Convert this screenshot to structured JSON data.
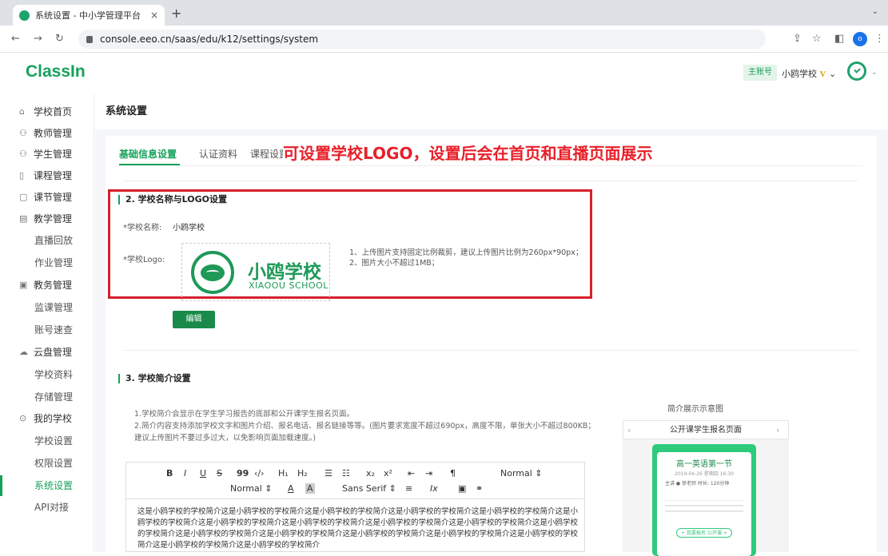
{
  "browser": {
    "tab_title": "系统设置 - 中小学管理平台",
    "tab_close": "×",
    "new_tab": "+",
    "url": "console.eeo.cn/saas/edu/k12/settings/system",
    "profile_initial": "o"
  },
  "header": {
    "logo": "ClassIn",
    "account_badge": "主账号",
    "school_name": "小鸥学校",
    "vip": "V"
  },
  "sidebar": {
    "items": [
      {
        "label": "学校首页",
        "icon": "⌂"
      },
      {
        "label": "教师管理",
        "icon": "⚇"
      },
      {
        "label": "学生管理",
        "icon": "⚇"
      },
      {
        "label": "课程管理",
        "icon": "▯"
      },
      {
        "label": "课节管理",
        "icon": "▢"
      },
      {
        "label": "教学管理",
        "icon": "▤"
      },
      {
        "label": "直播回放"
      },
      {
        "label": "作业管理"
      },
      {
        "label": "教务管理",
        "icon": "▣"
      },
      {
        "label": "监课管理"
      },
      {
        "label": "账号速查"
      },
      {
        "label": "云盘管理",
        "icon": "☁"
      },
      {
        "label": "学校资料"
      },
      {
        "label": "存储管理"
      },
      {
        "label": "我的学校",
        "icon": "⊙"
      },
      {
        "label": "学校设置"
      },
      {
        "label": "权限设置"
      },
      {
        "label": "系统设置"
      },
      {
        "label": "API对接"
      }
    ]
  },
  "page": {
    "title": "系统设置",
    "tabs": [
      "基础信息设置",
      "认证资料",
      "课程设置"
    ],
    "callout": "可设置学校LOGO，设置后会在首页和直播页面展示",
    "section2": {
      "heading": "2. 学校名称与LOGO设置",
      "name_label": "*学校名称:",
      "name_value": "小鸥学校",
      "logo_label": "*学校Logo:",
      "logo_cn": "小鸥学校",
      "logo_en": "XIAOOU SCHOOL",
      "tip1": "1、上传图片支持固定比例裁剪，建议上传图片比例为260px*90px；",
      "tip2": "2、图片大小不超过1MB；",
      "edit_button": "编辑"
    },
    "section3": {
      "heading": "3. 学校简介设置",
      "note1": "1.学校简介会显示在学生学习报告的底部和公开课学生报名页面。",
      "note2": "2.简介内容支持添加学校文字和图片介绍、报名电话、报名链接等等。(图片要求宽度不超过690px，高度不限，单张大小不超过800KB；建议上传图片不要过多过大，以免影响页面加载速度。)",
      "content": "这是小鸥学校的学校简介这是小鸥学校的学校简介这是小鸥学校的学校简介这是小鸥学校的学校简介这是小鸥学校的学校简介这是小鸥学校的学校简介这是小鸥学校的学校简介这是小鸥学校的学校简介这是小鸥学校的学校简介这是小鸥学校的学校简介这是小鸥学校的学校简介这是小鸥学校的学校简介这是小鸥学校的学校简介这是小鸥学校的学校简介这是小鸥学校的学校简介这是小鸥学校的学校简介这是小鸥学校的学校简介这是小鸥学校的学校简介"
    },
    "editor_toolbar": {
      "bold": "B",
      "italic": "I",
      "underline": "U",
      "strike": "S",
      "quote": "99",
      "code": "‹/›",
      "h1": "H₁",
      "h2": "H₂",
      "ol": "☰",
      "ul": "☷",
      "sub": "x₂",
      "sup": "x²",
      "outdent": "⇤",
      "indent": "⇥",
      "rtl": "¶",
      "size_select": "Normal ⇕",
      "header_select": "Normal ⇕",
      "color": "A",
      "bg": "A",
      "font_select": "Sans Serif ⇕",
      "align": "≡",
      "clean": "Ix",
      "image": "▣",
      "link": "⚭"
    },
    "preview": {
      "title": "简介展示示意图",
      "header": "公开课学生报名页面",
      "course": "高一英语第一节",
      "date": "2019-04-26 星期四 16:30",
      "row": "主讲 ● 徐老师  时长: 120分钟",
      "button": "+ 我要报名 公开课 +"
    }
  }
}
